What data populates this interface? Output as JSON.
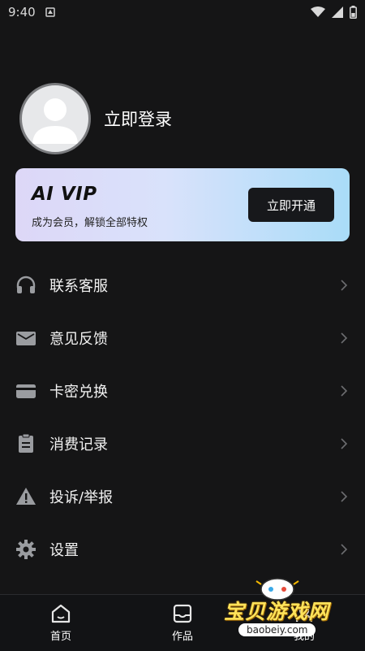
{
  "status_bar": {
    "time": "9:40"
  },
  "profile": {
    "login_label": "立即登录"
  },
  "vip": {
    "title": "AI VIP",
    "subtitle": "成为会员，解锁全部特权",
    "button_label": "立即开通"
  },
  "menu": {
    "items": [
      {
        "label": "联系客服",
        "icon": "headset-icon"
      },
      {
        "label": "意见反馈",
        "icon": "mail-icon"
      },
      {
        "label": "卡密兑换",
        "icon": "card-icon"
      },
      {
        "label": "消费记录",
        "icon": "clipboard-icon"
      },
      {
        "label": "投诉/举报",
        "icon": "warning-icon"
      },
      {
        "label": "设置",
        "icon": "gear-icon"
      }
    ]
  },
  "bottom_nav": {
    "items": [
      {
        "label": "首页",
        "icon": "home-icon"
      },
      {
        "label": "作品",
        "icon": "inbox-icon"
      },
      {
        "label": "我的",
        "icon": "user-icon"
      }
    ]
  },
  "watermark": {
    "text": "宝贝游戏网",
    "url": "baobeiy.com"
  },
  "colors": {
    "background": "#151516",
    "vip_gradient_start": "#ddd7f7",
    "vip_gradient_end": "#a9dcf8",
    "icon": "#9a9ca0"
  }
}
